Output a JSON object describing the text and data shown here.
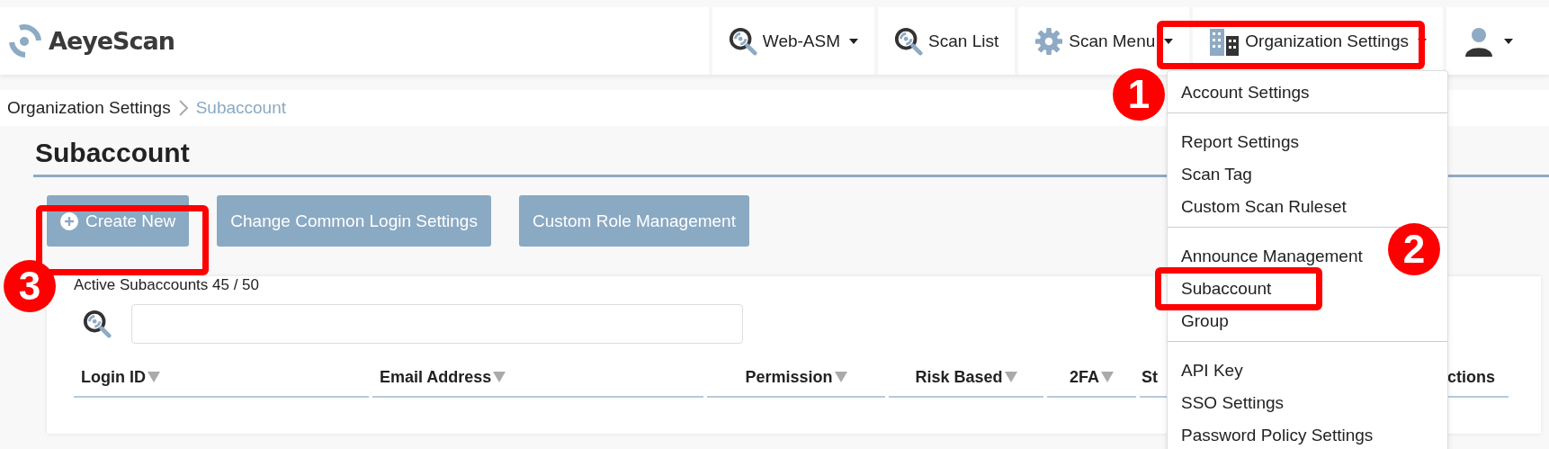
{
  "header": {
    "logo": "AeyeScan",
    "nav": [
      {
        "kind": "search",
        "label": "Web-ASM",
        "caret": true
      },
      {
        "kind": "search",
        "label": "Scan List",
        "caret": false
      },
      {
        "kind": "gear",
        "label": "Scan Menu",
        "caret": true
      },
      {
        "kind": "building",
        "label": "Organization Settings",
        "caret": true
      },
      {
        "kind": "user",
        "caret": true
      }
    ]
  },
  "breadcrumb": [
    "Organization Settings",
    "Subaccount"
  ],
  "page_title": "Subaccount",
  "buttons": [
    {
      "kind": "add",
      "label": "Create New"
    },
    {
      "kind": "plain",
      "label": "Change Common Login Settings"
    },
    {
      "kind": "plain",
      "label": "Custom Role Management"
    }
  ],
  "card": {
    "count_label": "Active Subaccounts 45 / 50",
    "table": {
      "columns": [
        {
          "label": "Login ID",
          "sortable": true
        },
        {
          "label": "Email Address",
          "sortable": true
        },
        {
          "label": "Permission",
          "sortable": true
        },
        {
          "label": "Risk Based",
          "sortable": true
        },
        {
          "label": "2FA",
          "sortable": true
        },
        {
          "label": "St",
          "sortable": false
        },
        {
          "label": "ctions",
          "sortable": false
        }
      ]
    }
  },
  "dropdown": {
    "groups": [
      [
        "Account Settings"
      ],
      [
        "Report Settings",
        "Scan Tag",
        "Custom Scan Ruleset"
      ],
      [
        "Announce Management",
        "Subaccount",
        "Group"
      ],
      [
        "API Key",
        "SSO Settings",
        "Password Policy Settings"
      ]
    ]
  },
  "annotations": [
    {
      "number": "1"
    },
    {
      "number": "2"
    },
    {
      "number": "3"
    }
  ]
}
